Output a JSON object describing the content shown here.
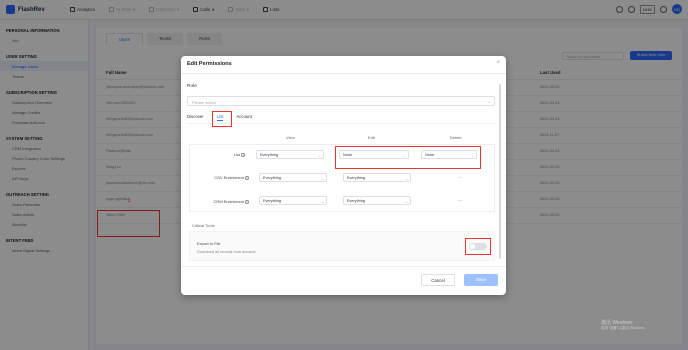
{
  "app": {
    "name": "FlashRev",
    "brand_color": "#2f6bff"
  },
  "topnav": {
    "items": [
      {
        "label": "Analytics",
        "icon": "chart-icon",
        "dim": false
      },
      {
        "label": "AI Flow",
        "icon": "flow-icon",
        "dim": true
      },
      {
        "label": "Outreach",
        "icon": "outreach-icon",
        "dim": true
      },
      {
        "label": "Calls",
        "icon": "phone-icon",
        "dim": false
      },
      {
        "label": "Data",
        "icon": "database-icon",
        "dim": true
      },
      {
        "label": "Lists",
        "icon": "list-icon",
        "dim": false
      }
    ],
    "credits_label": "161K",
    "avatar_initials": "HD"
  },
  "sidebar": {
    "sections": [
      {
        "title": "Personal Information",
        "items": [
          "You"
        ]
      },
      {
        "title": "User Setting",
        "items": [
          "Manage Users",
          "Teams"
        ]
      },
      {
        "title": "Subscription Setting",
        "items": [
          "Subscription Overview",
          "Manage Credits",
          "Purchase Add-ons"
        ]
      },
      {
        "title": "System Setting",
        "items": [
          "CRM Integration",
          "Phone Country Code Settings",
          "Exports",
          "API Keys"
        ]
      },
      {
        "title": "Outreach Setting",
        "items": [
          "Sales Personas",
          "Sales Admin",
          "Blacklist"
        ]
      },
      {
        "title": "Intent Feed",
        "items": [
          "Intent Signal Settings"
        ]
      }
    ],
    "active_item": "Manage Users"
  },
  "main": {
    "tabs": [
      "Users",
      "Teams",
      "Roles"
    ],
    "active_tab": "Users",
    "search_placeholder": "Search by user name",
    "add_button": "Add New User",
    "columns": {
      "name": "Full Name",
      "last_used": "Last Used"
    },
    "rows": [
      {
        "name": "johnsphenspenspen@outlook.com",
        "last_used": "2024-05-23"
      },
      {
        "name": "xfm.com3900403",
        "last_used": "2024-04-24"
      },
      {
        "name": "hengenzun63@outlook.com",
        "last_used": "2024-04-24"
      },
      {
        "name": "hengenzun63@outlook.com",
        "last_used": "2024-11-27"
      },
      {
        "name": "Flashrev@tails",
        "last_used": "2024-04-23"
      },
      {
        "name": "liangji Lu",
        "last_used": "2024-02-29"
      },
      {
        "name": "jacobinnolitashrevr@ceo.info",
        "last_used": "2024-02-29"
      },
      {
        "name": "roger.g@falsa",
        "last_used": "2024-04-26"
      },
      {
        "name": "Neon Chen",
        "last_used": "2024-05-23"
      }
    ]
  },
  "modal": {
    "title": "Edit Permissions",
    "role_label": "Role",
    "role_placeholder": "Please select",
    "tabs": [
      "Discover",
      "List",
      "Account"
    ],
    "active_tab": "List",
    "columns": {
      "view": "View",
      "edit": "Edit",
      "delete": "Delete"
    },
    "rows": [
      {
        "label": "List",
        "view": "Everything",
        "edit": "None",
        "delete": "None"
      },
      {
        "label": "CSV Enrichment",
        "view": "Everything",
        "edit": "Everything",
        "delete": "—"
      },
      {
        "label": "CRM Enrichment",
        "view": "Everything",
        "edit": "Everything",
        "delete": "—"
      }
    ],
    "critical_tools_label": "Critical Tools",
    "export_title": "Export to File",
    "export_desc": "Download all records from account.",
    "export_enabled": false,
    "cancel_label": "Cancel",
    "save_label": "Save"
  },
  "watermark": {
    "line1": "激活 Windows",
    "line2": "转到\"设置\"以激活 Windows。"
  }
}
